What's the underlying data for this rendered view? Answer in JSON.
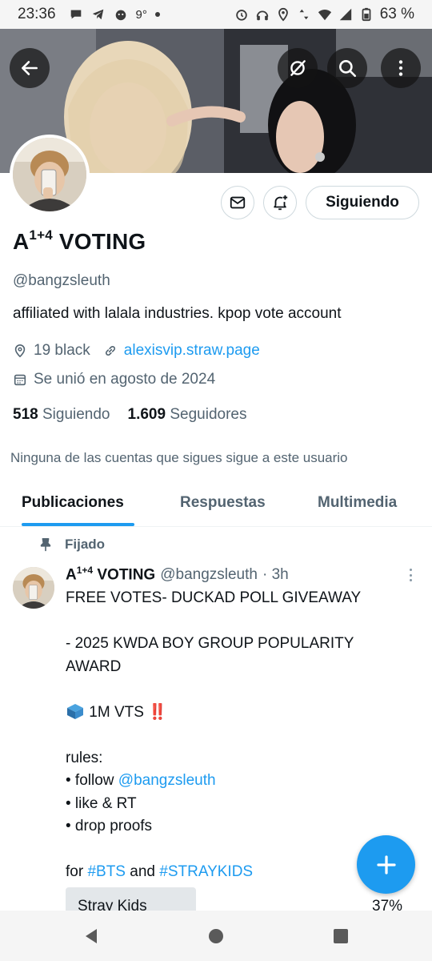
{
  "status_bar": {
    "time": "23:36",
    "temperature": "9°",
    "battery": "63 %"
  },
  "profile": {
    "name_base": "A",
    "name_sup": "1+4",
    "name_rest": " VOTING",
    "handle": "@bangzsleuth",
    "bio": "affiliated with lalala industries. kpop vote account",
    "location": "19 black",
    "website": "alexisvip.straw.page",
    "joined": "Se unió en agosto de 2024",
    "following_count": "518",
    "following_label": "Siguiendo",
    "followers_count": "1.609",
    "followers_label": "Seguidores",
    "no_mutuals": "Ninguna de las cuentas que sigues sigue a este usuario",
    "follow_button": "Siguiendo"
  },
  "tabs": [
    {
      "label": "Publicaciones",
      "active": true
    },
    {
      "label": "Respuestas",
      "active": false
    },
    {
      "label": "Multimedia",
      "active": false
    }
  ],
  "tweet": {
    "pinned_label": "Fijado",
    "name_base": "A",
    "name_sup": "1+4",
    "name_rest": " VOTING",
    "handle": "@bangzsleuth",
    "time": "· 3h",
    "line1": "FREE VOTES- DUCKAD POLL GIVEAWAY",
    "line2": "- 2025 KWDA BOY GROUP POPULARITY",
    "line3": "AWARD",
    "votes_text": " 1M VTS ",
    "exclaim": "‼️",
    "rules_title": "rules:",
    "rule1_prefix": "• follow ",
    "rule1_link": "@bangzsleuth",
    "rule2": "• like & RT",
    "rule3": "• drop proofs",
    "for_prefix": "for ",
    "hashtag1": "#BTS",
    "and_text": " and ",
    "hashtag2": "#STRAYKIDS",
    "poll_option": "Stray Kids",
    "poll_percent": "37%"
  },
  "colors": {
    "accent": "#1d9bf0",
    "muted": "#536471",
    "text": "#0f1419"
  }
}
